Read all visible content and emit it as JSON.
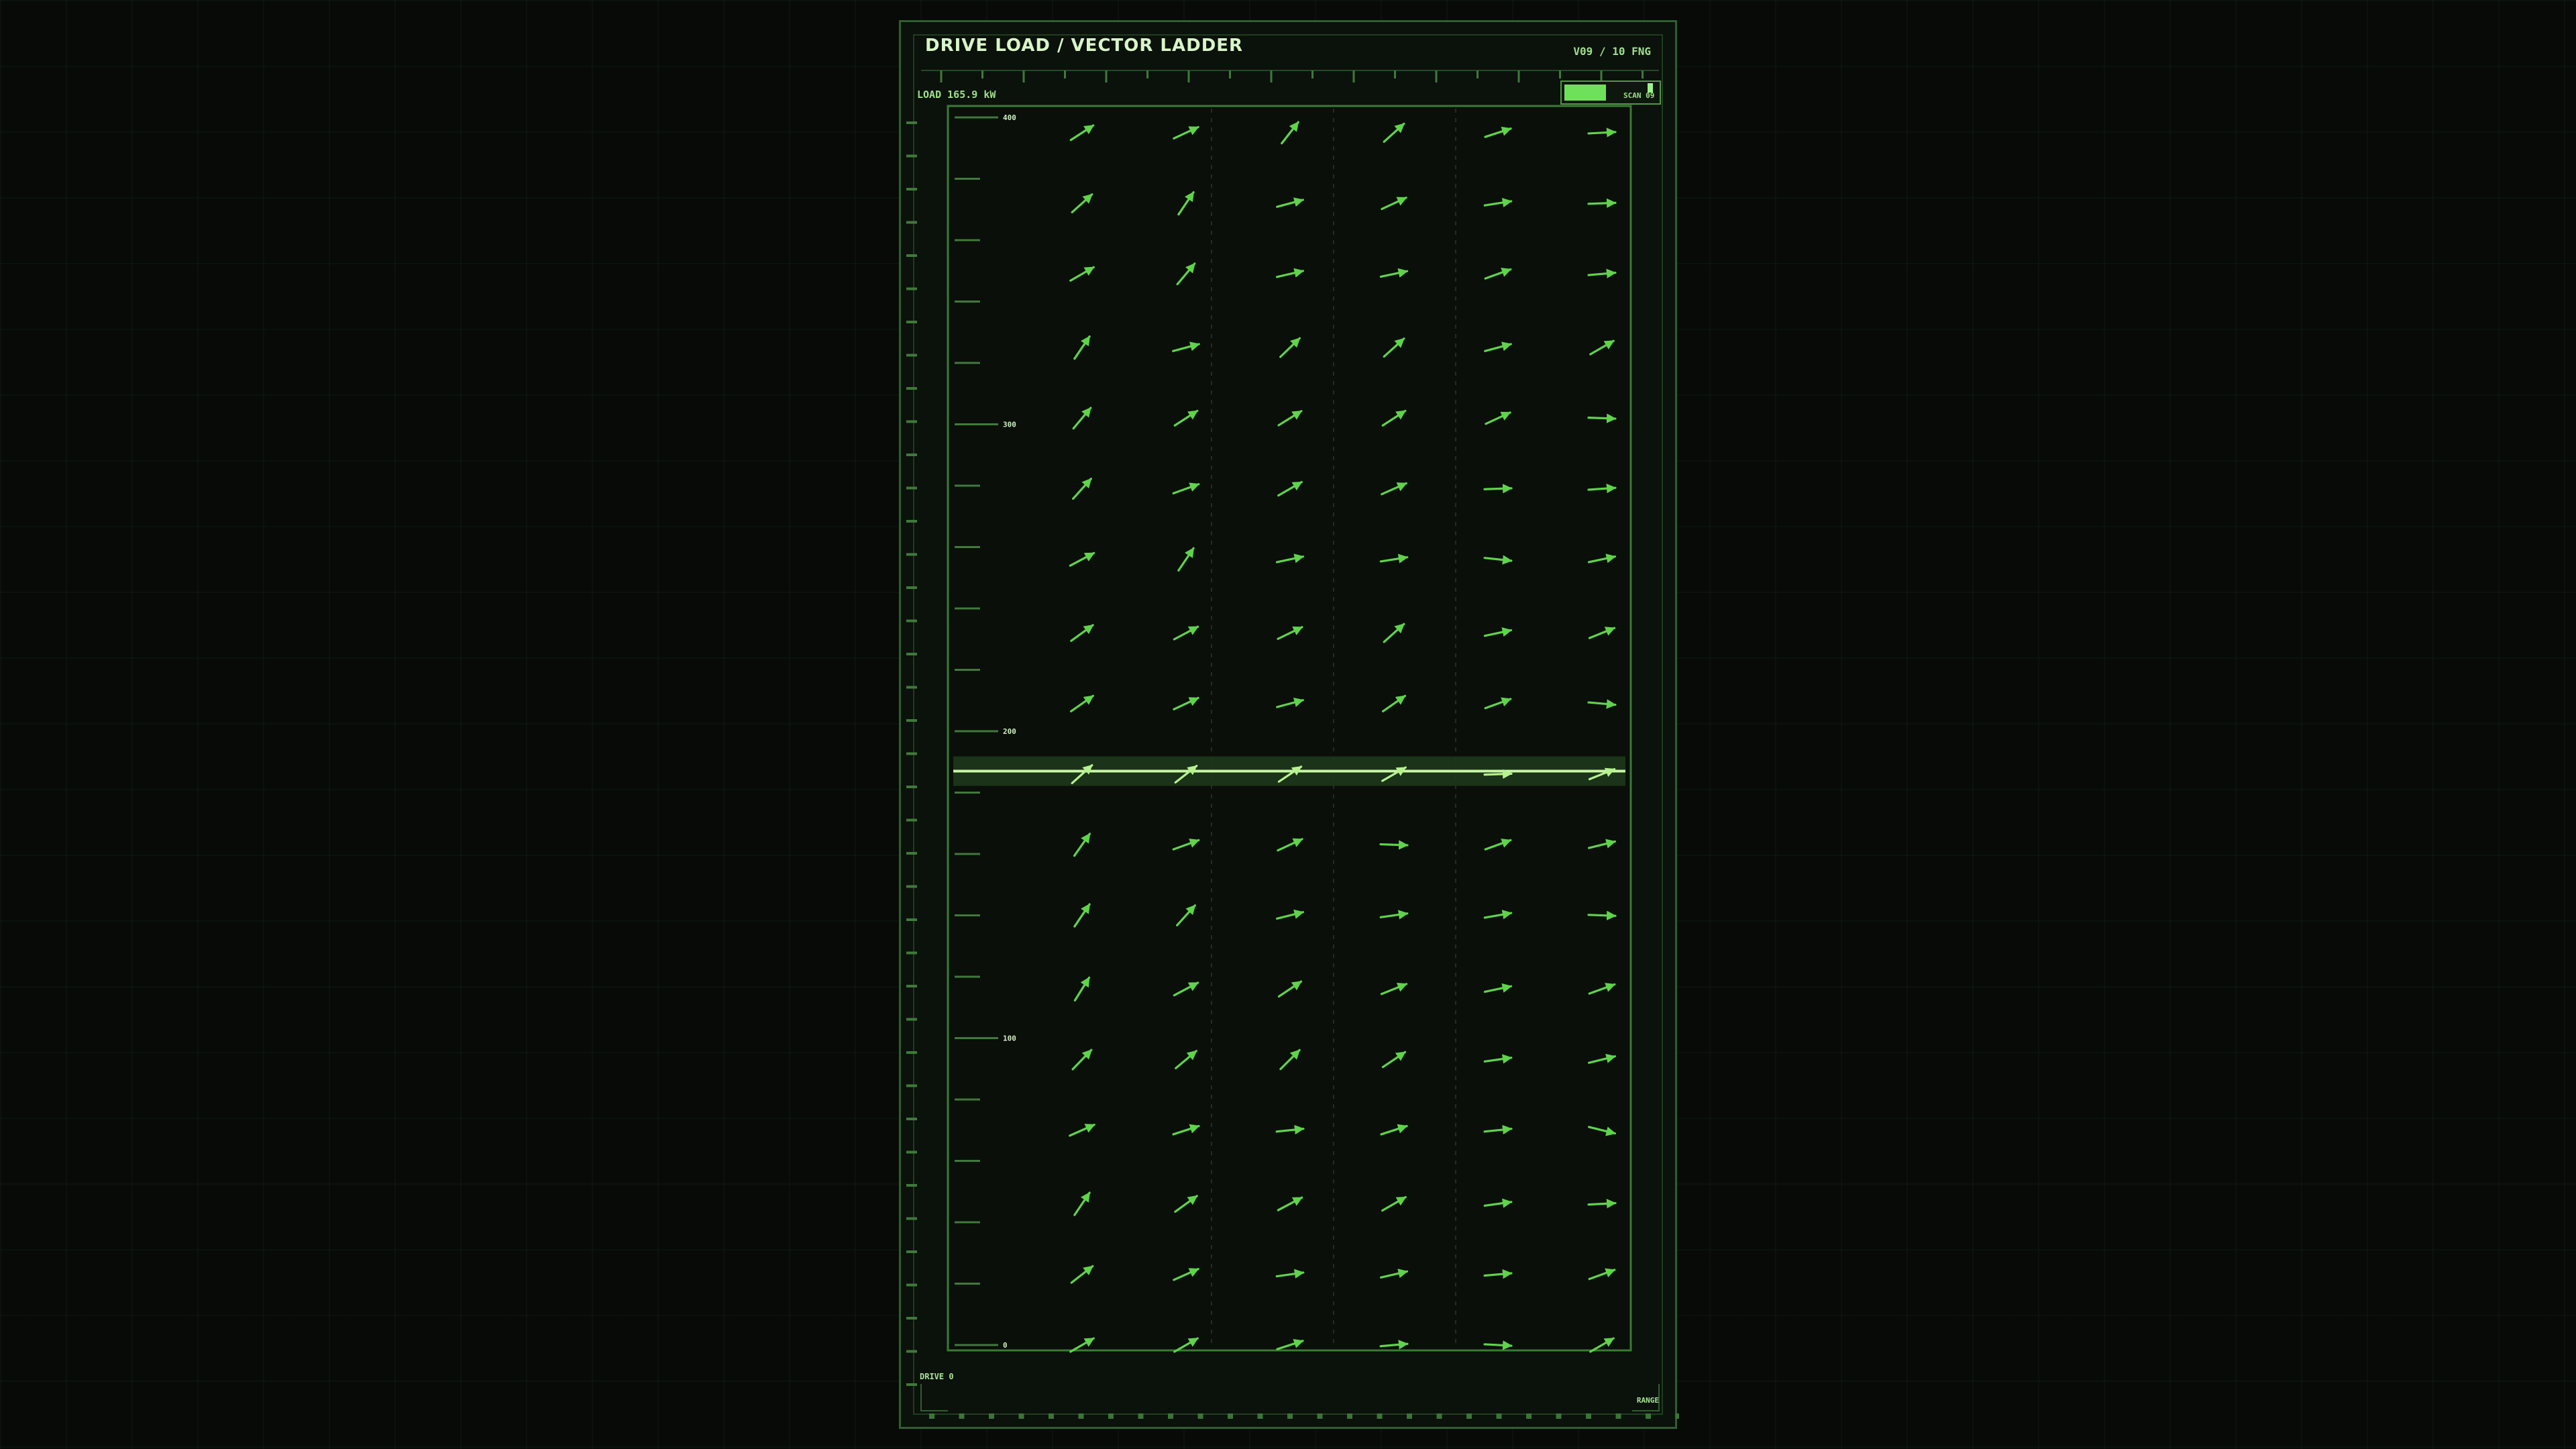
{
  "header": {
    "title": "DRIVE LOAD / VECTOR LADDER",
    "version": "V09 / 10  FNG"
  },
  "readout": {
    "load": "LOAD 165.9 kW"
  },
  "scan": {
    "label": "SCAN 09",
    "fill_fraction": 0.45,
    "marker_fraction": 0.9
  },
  "footer": {
    "drive_label": "DRIVE 0",
    "range_label": "RANGE"
  },
  "colors": {
    "arrow": "#5fd44a",
    "arrow_highlight": "#b6f28f",
    "frame": "#2f5e2f",
    "tick": "#3f7a3a",
    "current_band": "#1e3a1b",
    "current_line": "#c8f7a2"
  },
  "chart_data": {
    "type": "vector-field",
    "y_range": [
      0,
      400
    ],
    "y_ticks": [
      {
        "value": 400,
        "label": "400"
      },
      {
        "value": 300,
        "label": "300"
      },
      {
        "value": 200,
        "label": "200"
      },
      {
        "value": 100,
        "label": "100"
      },
      {
        "value": 0,
        "label": "0"
      }
    ],
    "current_value": 187,
    "columns": 6,
    "rows": [
      {
        "y": 395,
        "angles": [
          33,
          25,
          52,
          42,
          18,
          3
        ]
      },
      {
        "y": 372,
        "angles": [
          42,
          56,
          15,
          25,
          9,
          2
        ]
      },
      {
        "y": 349,
        "angles": [
          30,
          50,
          13,
          12,
          20,
          5
        ]
      },
      {
        "y": 325,
        "angles": [
          56,
          15,
          44,
          42,
          15,
          30
        ]
      },
      {
        "y": 302,
        "angles": [
          50,
          33,
          32,
          33,
          25,
          -2
        ]
      },
      {
        "y": 279,
        "angles": [
          48,
          20,
          30,
          24,
          2,
          4
        ]
      },
      {
        "y": 256,
        "angles": [
          28,
          56,
          12,
          9,
          -6,
          12
        ]
      },
      {
        "y": 232,
        "angles": [
          36,
          28,
          26,
          42,
          12,
          22
        ]
      },
      {
        "y": 209,
        "angles": [
          35,
          25,
          15,
          35,
          20,
          -5
        ]
      },
      {
        "y": 186,
        "angles": [
          42,
          38,
          34,
          30,
          2,
          22
        ]
      },
      {
        "y": 163,
        "angles": [
          55,
          20,
          25,
          -2,
          20,
          14
        ]
      },
      {
        "y": 140,
        "angles": [
          56,
          48,
          14,
          8,
          10,
          -2
        ]
      },
      {
        "y": 116,
        "angles": [
          58,
          28,
          34,
          22,
          12,
          20
        ]
      },
      {
        "y": 93,
        "angles": [
          46,
          40,
          45,
          34,
          8,
          14
        ]
      },
      {
        "y": 70,
        "angles": [
          24,
          18,
          6,
          18,
          6,
          -14
        ]
      },
      {
        "y": 46,
        "angles": [
          56,
          36,
          28,
          30,
          8,
          3
        ]
      },
      {
        "y": 23,
        "angles": [
          38,
          24,
          8,
          13,
          5,
          20
        ]
      },
      {
        "y": 0,
        "angles": [
          30,
          30,
          18,
          5,
          -3,
          30
        ]
      }
    ]
  }
}
